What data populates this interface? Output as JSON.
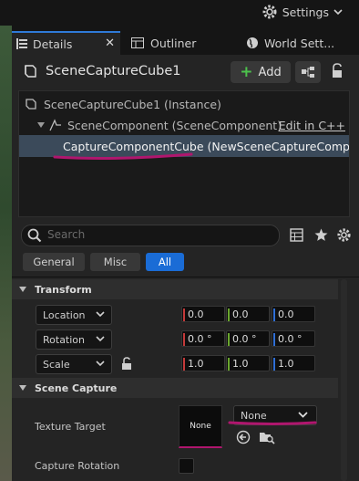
{
  "toolbar": {
    "settings_label": "Settings"
  },
  "tabs": [
    {
      "label": "Details"
    },
    {
      "label": "Outliner"
    },
    {
      "label": "World Sett..."
    }
  ],
  "details": {
    "actor_name": "SceneCaptureCube1",
    "add_label": "Add",
    "components": [
      {
        "label": "SceneCaptureCube1 (Instance)"
      },
      {
        "label": "SceneComponent (SceneComponent)",
        "action": "Edit in C++"
      },
      {
        "label": "CaptureComponentCube (NewSceneCaptureComponentCube)"
      }
    ],
    "search_placeholder": "Search",
    "filters": [
      "General",
      "Misc",
      "All"
    ]
  },
  "transform": {
    "section_label": "Transform",
    "rows": [
      {
        "label": "Location",
        "values": [
          "0.0",
          "0.0",
          "0.0"
        ]
      },
      {
        "label": "Rotation",
        "values": [
          "0.0 °",
          "0.0 °",
          "0.0 °"
        ]
      },
      {
        "label": "Scale",
        "values": [
          "1.0",
          "1.0",
          "1.0"
        ]
      }
    ]
  },
  "scene_capture": {
    "section_label": "Scene Capture",
    "texture_target_label": "Texture Target",
    "texture_thumb_label": "None",
    "texture_dropdown_value": "None",
    "capture_rotation_label": "Capture Rotation"
  },
  "colors": {
    "accent": "#2f7ad8",
    "annotation": "#b0166e",
    "x_axis": "#c43a3a",
    "y_axis": "#6aa62e",
    "z_axis": "#2f6fd6"
  }
}
